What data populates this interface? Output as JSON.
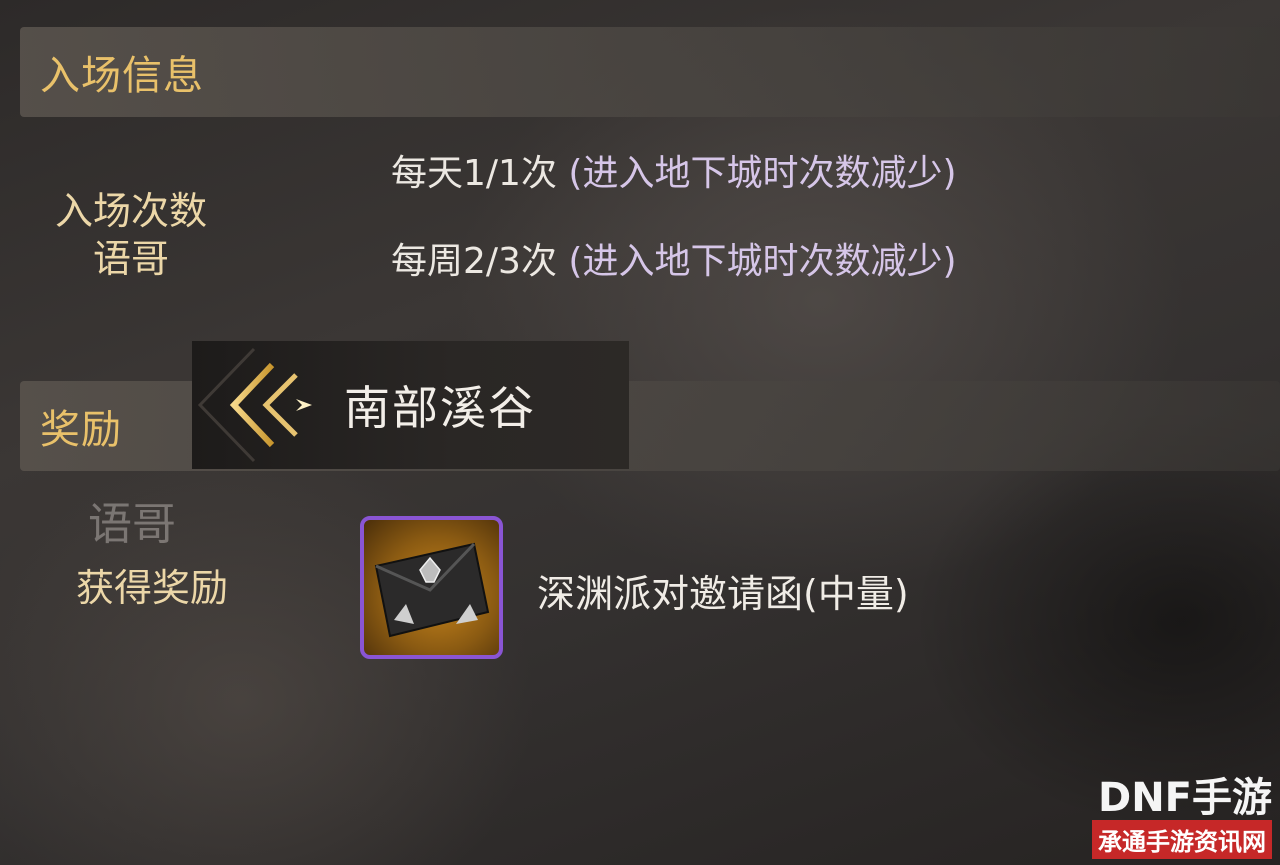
{
  "entry_section": {
    "title": "入场信息",
    "label_line1": "入场次数",
    "label_line2": "语哥",
    "daily": {
      "count": "每天1/1次",
      "note": "(进入地下城时次数减少)"
    },
    "weekly": {
      "count": "每周2/3次",
      "note": "(进入地下城时次数减少)"
    }
  },
  "dungeon": {
    "name": "南部溪谷"
  },
  "reward_section": {
    "title": "奖励",
    "watermark": "语哥",
    "label": "获得奖励",
    "item_name": "深渊派对邀请函(中量)"
  },
  "logo": {
    "top": "DNF手游",
    "bottom": "承通手游资讯网"
  },
  "colors": {
    "header_text": "#e9c16a",
    "label_text": "#ecd7a8",
    "item_border": "#8a55d4",
    "logo_red": "#c62828"
  },
  "icons": {
    "back": "chevron-back-icon",
    "item": "invitation-letter-icon"
  }
}
